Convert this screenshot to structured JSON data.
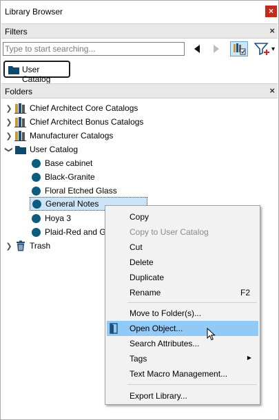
{
  "window": {
    "title": "Library Browser",
    "close_glyph": "×"
  },
  "filters": {
    "header": "Filters",
    "close_glyph": "×",
    "search_placeholder": "Type to start searching...",
    "search_value": "",
    "buttons": [
      "back-arrow-icon",
      "forward-arrow-icon",
      "catalog-filter-icon",
      "add-filter-icon"
    ],
    "dropdown_glyph": "▾",
    "selected_catalog": "User Catalog"
  },
  "folders": {
    "header": "Folders",
    "close_glyph": "×",
    "items": [
      {
        "label": "Chief Architect Core Catalogs",
        "icon": "catalog-books-icon",
        "arrow": ">"
      },
      {
        "label": "Chief Architect Bonus Catalogs",
        "icon": "catalog-books-icon",
        "arrow": ">"
      },
      {
        "label": "Manufacturer Catalogs",
        "icon": "catalog-books-icon",
        "arrow": ">"
      },
      {
        "label": "User Catalog",
        "icon": "folder-icon",
        "arrow": "v"
      },
      {
        "label": "Base cabinet",
        "icon": "object-dot-icon"
      },
      {
        "label": "Black-Granite",
        "icon": "object-dot-icon"
      },
      {
        "label": "Floral Etched Glass",
        "icon": "object-dot-icon"
      },
      {
        "label": "General Notes",
        "icon": "object-dot-icon",
        "selected": true
      },
      {
        "label": "Hoya 3",
        "icon": "object-dot-icon"
      },
      {
        "label": "Plaid-Red and G",
        "icon": "object-dot-icon"
      },
      {
        "label": "Trash",
        "icon": "trash-icon",
        "arrow": ">"
      }
    ]
  },
  "context_menu": {
    "items": [
      {
        "label": "Copy"
      },
      {
        "label": "Copy to User Catalog",
        "disabled": true
      },
      {
        "label": "Cut"
      },
      {
        "label": "Delete"
      },
      {
        "label": "Duplicate"
      },
      {
        "label": "Rename",
        "shortcut": "F2"
      },
      {
        "label": "Move to Folder(s)..."
      },
      {
        "label": "Open Object...",
        "highlighted": true
      },
      {
        "label": "Search Attributes..."
      },
      {
        "label": "Tags",
        "submenu": "▶"
      },
      {
        "label": "Text Macro Management..."
      },
      {
        "label": "Export Library..."
      }
    ]
  },
  "colors": {
    "accent": "#91c9f7",
    "selection": "#cce4f7",
    "close_red": "#c42b1c",
    "object_dot": "#0e5c7d"
  }
}
